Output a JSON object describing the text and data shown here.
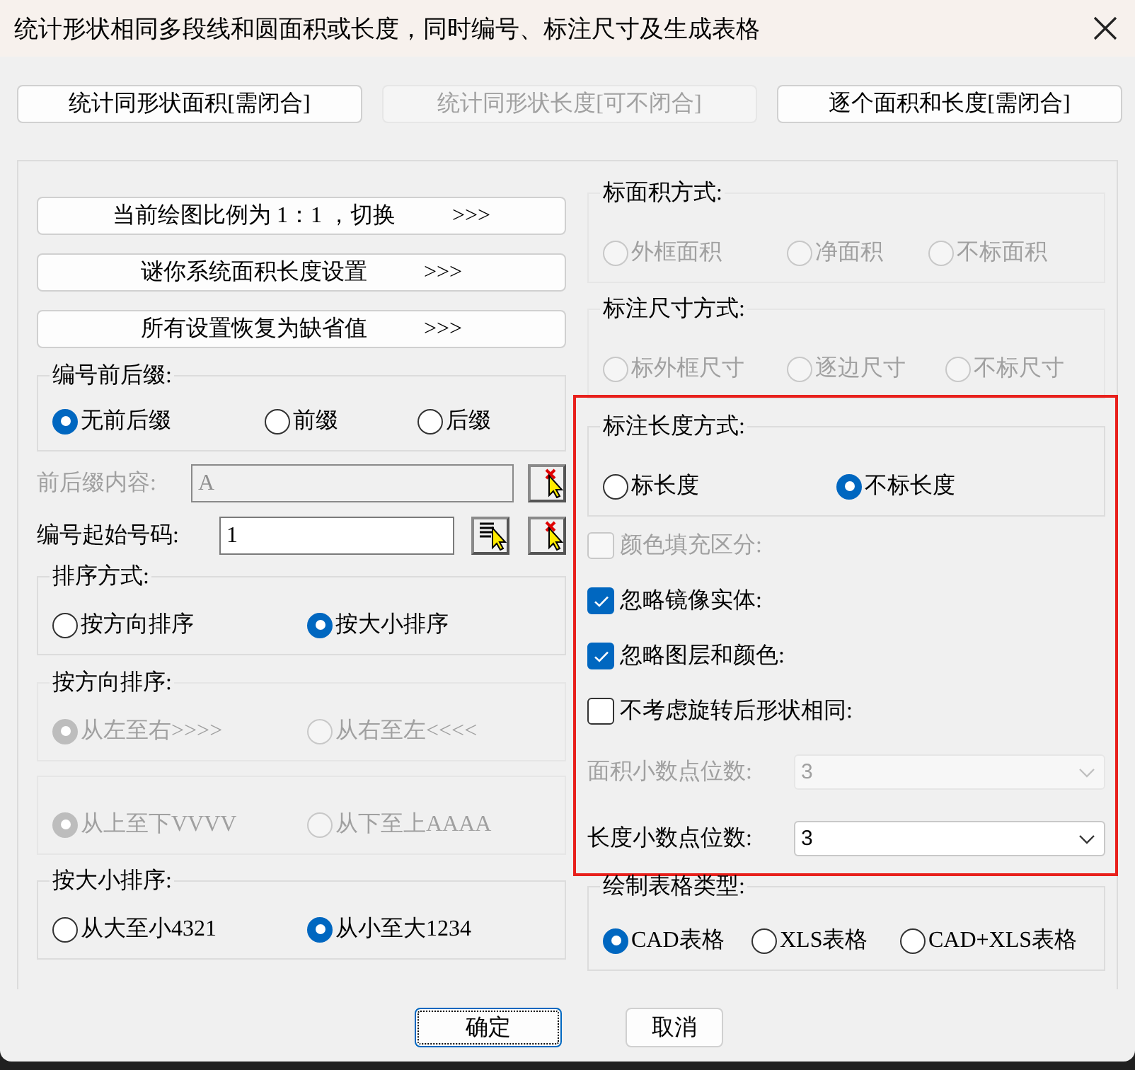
{
  "window": {
    "title": "统计形状相同多段线和圆面积或长度，同时编号、标注尺寸及生成表格"
  },
  "top_buttons": [
    {
      "label": "统计同形状面积[需闭合]",
      "disabled": false
    },
    {
      "label": "统计同形状长度[可不闭合]",
      "disabled": true
    },
    {
      "label": "逐个面积和长度[需闭合]",
      "disabled": false
    }
  ],
  "setting_buttons": [
    {
      "label": "当前绘图比例为 1：1 ，切换",
      "suffix": ">>>"
    },
    {
      "label": "谜你系统面积长度设置",
      "suffix": ">>>"
    },
    {
      "label": "所有设置恢复为缺省值",
      "suffix": ">>>"
    }
  ],
  "prefix_group": {
    "title": "编号前后缀:",
    "disabled": false,
    "options": [
      {
        "label": "无前后缀",
        "selected": true
      },
      {
        "label": "前缀",
        "selected": false
      },
      {
        "label": "后缀",
        "selected": false
      }
    ]
  },
  "prefix_content": {
    "label": "前后缀内容:",
    "value": "A",
    "disabled": true
  },
  "start_number": {
    "label": "编号起始号码:",
    "value": "1",
    "disabled": false
  },
  "sort_groups": [
    {
      "title": "排序方式:",
      "disabled": false,
      "options": [
        {
          "label": "按方向排序",
          "selected": false
        },
        {
          "label": "按大小排序",
          "selected": true
        }
      ]
    },
    {
      "title": "按方向排序:",
      "disabled": true,
      "options": [
        {
          "label": "从左至右>>>>",
          "selected": true
        },
        {
          "label": "从右至左<<<<",
          "selected": false
        }
      ]
    },
    {
      "disabled": true,
      "options": [
        {
          "label": "从上至下VVVV",
          "selected": true
        },
        {
          "label": "从下至上AAAA",
          "selected": false
        }
      ]
    },
    {
      "title": "按大小排序:",
      "disabled": false,
      "options": [
        {
          "label": "从大至小4321",
          "selected": false
        },
        {
          "label": "从小至大1234",
          "selected": true
        }
      ]
    }
  ],
  "area_mark": {
    "title": "标面积方式:",
    "disabled": true,
    "options": [
      {
        "label": "外框面积",
        "selected": false
      },
      {
        "label": "净面积",
        "selected": false
      },
      {
        "label": "不标面积",
        "selected": false
      }
    ]
  },
  "dimension_mark": {
    "title": "标注尺寸方式:",
    "disabled": true,
    "options": [
      {
        "label": "标外框尺寸",
        "selected": false
      },
      {
        "label": "逐边尺寸",
        "selected": false
      },
      {
        "label": "不标尺寸",
        "selected": false
      }
    ]
  },
  "highlighted_section": {
    "highlighted": true,
    "length_mark": {
      "title": "标注长度方式:",
      "disabled": false,
      "options": [
        {
          "label": "标长度",
          "selected": false
        },
        {
          "label": "不标长度",
          "selected": true
        }
      ]
    },
    "checkboxes": [
      {
        "label": "颜色填充区分:",
        "checked": false,
        "disabled": true
      },
      {
        "label": "忽略镜像实体:",
        "checked": true,
        "disabled": false
      },
      {
        "label": "忽略图层和颜色:",
        "checked": true,
        "disabled": false
      },
      {
        "label": "不考虑旋转后形状相同:",
        "checked": false,
        "disabled": false
      }
    ],
    "dropdowns": [
      {
        "label": "面积小数点位数:",
        "value": "3",
        "disabled": true
      },
      {
        "label": "长度小数点位数:",
        "value": "3",
        "disabled": false
      }
    ]
  },
  "table_type": {
    "title": "绘制表格类型:",
    "disabled": false,
    "options": [
      {
        "label": "CAD表格",
        "selected": true
      },
      {
        "label": "XLS表格",
        "selected": false
      },
      {
        "label": "CAD+XLS表格",
        "selected": false
      }
    ]
  },
  "footer_buttons": [
    {
      "label": "确定",
      "default": true
    },
    {
      "label": "取消",
      "default": false
    }
  ]
}
